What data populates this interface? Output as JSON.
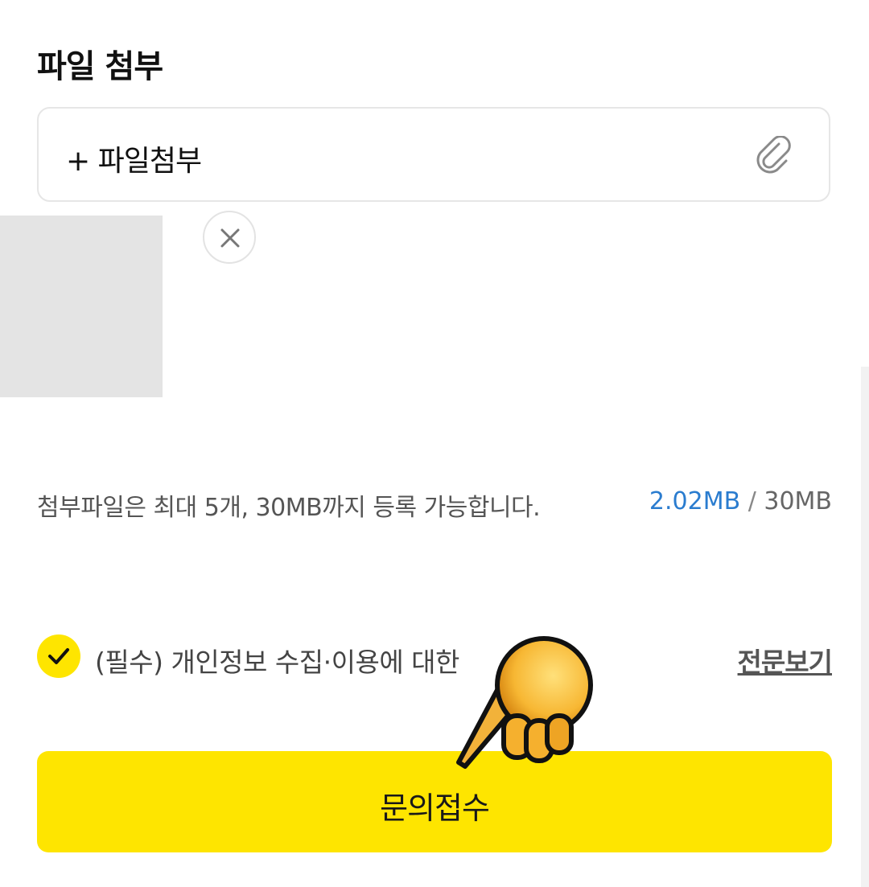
{
  "section": {
    "title": "파일 첨부"
  },
  "attach": {
    "label": "+ 파일첨부",
    "icon": "paperclip-icon"
  },
  "attachment": {
    "remove_icon": "close-icon"
  },
  "notice": {
    "text": "첨부파일은 최대 5개, 30MB까지 등록 가능합니다.",
    "used": "2.02MB",
    "separator": " / ",
    "limit": "30MB"
  },
  "consent": {
    "text": "(필수) 개인정보 수집·이용에 대한",
    "checked": true,
    "view_full": "전문보기"
  },
  "submit": {
    "label": "문의접수"
  },
  "colors": {
    "accent": "#fee500",
    "link_blue": "#2a7ccf",
    "text_dark": "#111111"
  }
}
